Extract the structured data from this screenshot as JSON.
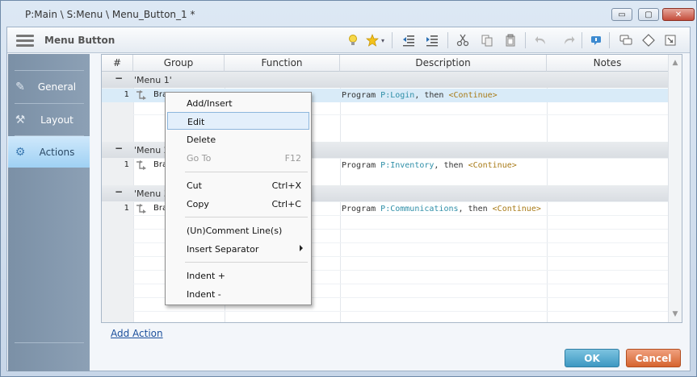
{
  "window": {
    "title": "P:Main \\ S:Menu \\ Menu_Button_1 *",
    "minimize": "▭",
    "maximize": "▢",
    "close": "✕"
  },
  "toolbar": {
    "title": "Menu Button"
  },
  "sidebar": {
    "items": [
      {
        "label": "General",
        "icon": "pencil-icon"
      },
      {
        "label": "Layout",
        "icon": "wrench-icon"
      },
      {
        "label": "Actions",
        "icon": "gears-icon",
        "active": true
      }
    ]
  },
  "grid": {
    "columns": [
      "#",
      "Group",
      "Function",
      "Description",
      "Notes"
    ],
    "groups": [
      {
        "name": "'Menu 1'",
        "row_num": "1",
        "group_text": "Bra",
        "desc": {
          "prefix": "Program ",
          "target": "P:Login",
          "mid": ", then ",
          "cont": "<Continue>"
        }
      },
      {
        "name": "'Menu 2'",
        "row_num": "1",
        "group_text": "Bra",
        "desc": {
          "prefix": "Program ",
          "target": "P:Inventory",
          "mid": ", then ",
          "cont": "<Continue>"
        }
      },
      {
        "name": "'Menu 3'",
        "row_num": "1",
        "group_text": "Bra",
        "desc": {
          "prefix": "Program ",
          "target": "P:Communications",
          "mid": ", then ",
          "cont": "<Continue>"
        }
      }
    ],
    "group_minus": "−"
  },
  "links": {
    "add_action": "Add Action"
  },
  "buttons": {
    "ok": "OK",
    "cancel": "Cancel"
  },
  "context_menu": {
    "add_insert": "Add/Insert",
    "edit": "Edit",
    "delete": "Delete",
    "go_to": "Go To",
    "go_to_shortcut": "F12",
    "cut": "Cut",
    "cut_shortcut": "Ctrl+X",
    "copy": "Copy",
    "copy_shortcut": "Ctrl+C",
    "uncomment": "(Un)Comment Line(s)",
    "insert_separator": "Insert Separator",
    "indent_plus": "Indent +",
    "indent_minus": "Indent -"
  }
}
